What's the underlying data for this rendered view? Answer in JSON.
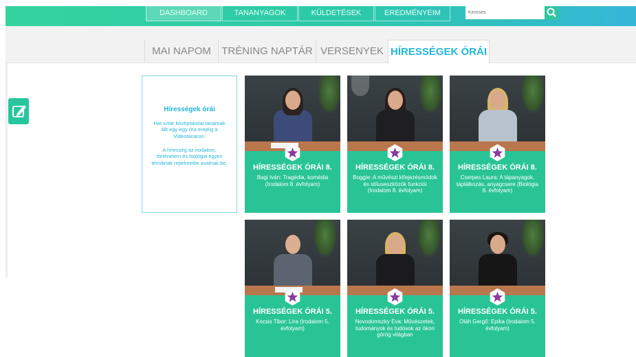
{
  "nav": {
    "items": [
      "DASHBOARD",
      "TANANYAGOK",
      "KÜLDETÉSEK",
      "EREDMÉNYEIM"
    ],
    "active_index": 0,
    "search_placeholder": "Keresés"
  },
  "tabs": {
    "items": [
      "MAI NAPOM",
      "TRÉNING NAPTÁR",
      "VERSENYEK",
      "HÍRESSÉGEK ÓRÁI"
    ],
    "active_index": 3
  },
  "info": {
    "title": "Hírességek órái",
    "desc1": "Hat sztár középiskolai tanárnak állt egy-egy óra erejéig a Videotanáron.",
    "desc2": "A híresség az irodalom, történelem és biológia egyes témáinak rejtelmeibe avatnak be."
  },
  "cards": [
    {
      "title": "HÍRESSÉGEK ÓRÁI 8.",
      "desc": "Bagi Iván: Tragédia, komédia (Irodalom 8. évfolyam)"
    },
    {
      "title": "HÍRESSÉGEK ÓRÁI 8.",
      "desc": "Boggie: A művészi kifejezésmódok és stíluseszközök funkciói (Irodalom 8. évfolyam)"
    },
    {
      "title": "HÍRESSÉGEK ÓRÁI 8.",
      "desc": "Cserpes Laura: A tápanyagok, táplálkozás, anyagcsere (Biológia 8. évfolyam)"
    },
    {
      "title": "HÍRESSÉGEK ÓRÁI 5.",
      "desc": "Kocsis Tibor: Líra (Irodalom 5. évfolyam)"
    },
    {
      "title": "HÍRESSÉGEK ÓRÁI 5.",
      "desc": "Novodomszky Éva: Művészetek, tudományok és tudósok az ókori görög világban"
    },
    {
      "title": "HÍRESSÉGEK ÓRÁI 5.",
      "desc": "Oláh Gergő: Epika (Irodalom 5. évfolyam)"
    }
  ],
  "icons": {
    "search": "search-icon",
    "edit": "edit-icon",
    "badge": "star-badge-icon"
  },
  "colors": {
    "accent_green": "#29c496",
    "accent_blue": "#23b6d6",
    "badge_purple": "#8a3aa0"
  }
}
